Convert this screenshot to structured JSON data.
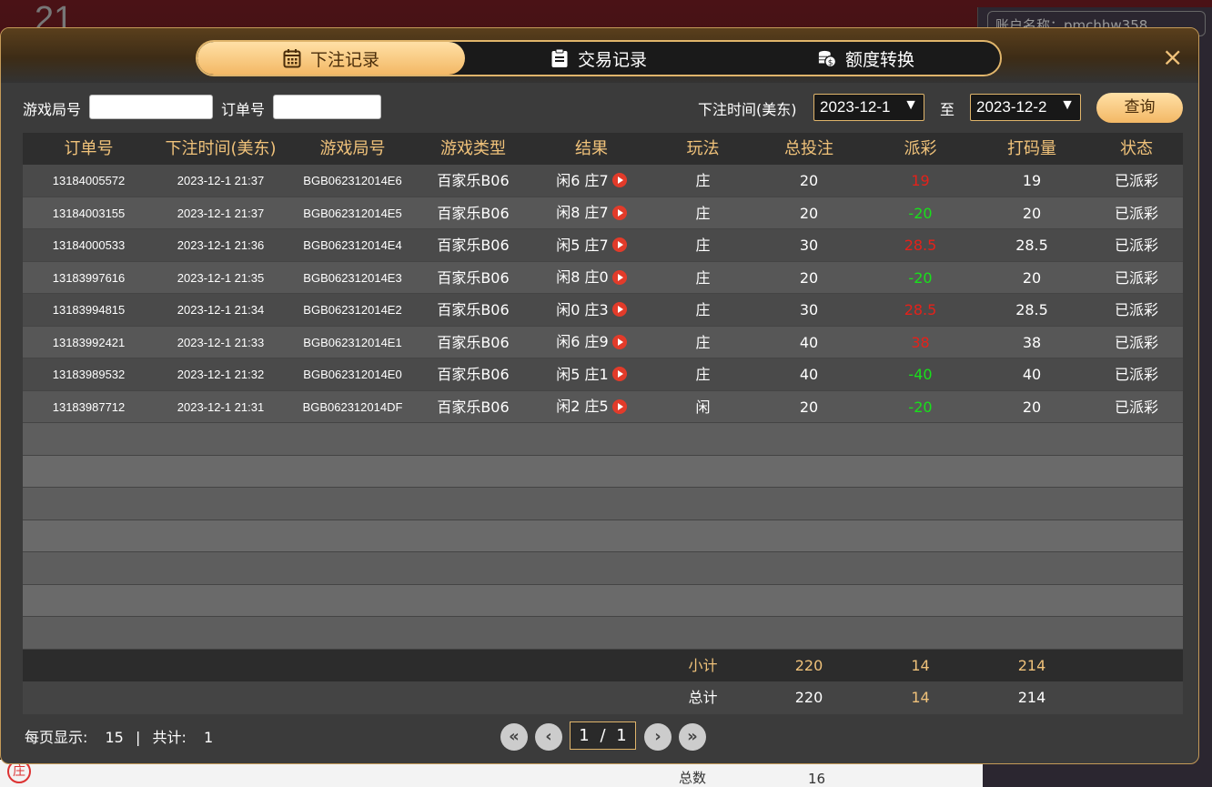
{
  "background": {
    "round_number": "21",
    "account_label": "账户名称：pmchhw358",
    "bottom_left_badge": "庄",
    "bottom_stat_label": "总数",
    "bottom_stat_value": "16"
  },
  "tabs": [
    {
      "label": "下注记录",
      "icon": "calendar-icon",
      "active": true
    },
    {
      "label": "交易记录",
      "icon": "clipboard-icon",
      "active": false
    },
    {
      "label": "额度转换",
      "icon": "coins-icon",
      "active": false
    }
  ],
  "close_label": "×",
  "filters": {
    "round_label": "游戏局号",
    "round_value": "",
    "order_label": "订单号",
    "order_value": "",
    "time_label": "下注时间(美东)",
    "date_from": "2023-12-1",
    "to_label": "至",
    "date_to": "2023-12-2",
    "query_label": "查询"
  },
  "table": {
    "headers": [
      "订单号",
      "下注时间(美东)",
      "游戏局号",
      "游戏类型",
      "结果",
      "玩法",
      "总投注",
      "派彩",
      "打码量",
      "状态"
    ],
    "rows": [
      {
        "order": "13184005572",
        "time": "2023-12-1 21:37",
        "round": "BGB062312014E6",
        "game": "百家乐B06",
        "result": "闲6 庄7",
        "play": "庄",
        "bet": "20",
        "payout": "19",
        "payout_sign": "pos",
        "turnover": "19",
        "status": "已派彩"
      },
      {
        "order": "13184003155",
        "time": "2023-12-1 21:37",
        "round": "BGB062312014E5",
        "game": "百家乐B06",
        "result": "闲8 庄7",
        "play": "庄",
        "bet": "20",
        "payout": "-20",
        "payout_sign": "neg",
        "turnover": "20",
        "status": "已派彩"
      },
      {
        "order": "13184000533",
        "time": "2023-12-1 21:36",
        "round": "BGB062312014E4",
        "game": "百家乐B06",
        "result": "闲5 庄7",
        "play": "庄",
        "bet": "30",
        "payout": "28.5",
        "payout_sign": "pos",
        "turnover": "28.5",
        "status": "已派彩"
      },
      {
        "order": "13183997616",
        "time": "2023-12-1 21:35",
        "round": "BGB062312014E3",
        "game": "百家乐B06",
        "result": "闲8 庄0",
        "play": "庄",
        "bet": "20",
        "payout": "-20",
        "payout_sign": "neg",
        "turnover": "20",
        "status": "已派彩"
      },
      {
        "order": "13183994815",
        "time": "2023-12-1 21:34",
        "round": "BGB062312014E2",
        "game": "百家乐B06",
        "result": "闲0 庄3",
        "play": "庄",
        "bet": "30",
        "payout": "28.5",
        "payout_sign": "pos",
        "turnover": "28.5",
        "status": "已派彩"
      },
      {
        "order": "13183992421",
        "time": "2023-12-1 21:33",
        "round": "BGB062312014E1",
        "game": "百家乐B06",
        "result": "闲6 庄9",
        "play": "庄",
        "bet": "40",
        "payout": "38",
        "payout_sign": "pos",
        "turnover": "38",
        "status": "已派彩"
      },
      {
        "order": "13183989532",
        "time": "2023-12-1 21:32",
        "round": "BGB062312014E0",
        "game": "百家乐B06",
        "result": "闲5 庄1",
        "play": "庄",
        "bet": "40",
        "payout": "-40",
        "payout_sign": "neg",
        "turnover": "40",
        "status": "已派彩"
      },
      {
        "order": "13183987712",
        "time": "2023-12-1 21:31",
        "round": "BGB062312014DF",
        "game": "百家乐B06",
        "result": "闲2 庄5",
        "play": "闲",
        "bet": "20",
        "payout": "-20",
        "payout_sign": "neg",
        "turnover": "20",
        "status": "已派彩"
      }
    ],
    "empty_rows": 7,
    "subtotal": {
      "label": "小计",
      "bet": "220",
      "payout": "14",
      "turnover": "214"
    },
    "total": {
      "label": "总计",
      "bet": "220",
      "payout": "14",
      "turnover": "214"
    }
  },
  "pagination": {
    "per_page_label": "每页显示:",
    "per_page_value": "15",
    "separator": "|",
    "total_label": "共计:",
    "total_value": "1",
    "current_page": "1",
    "slash": "/",
    "total_pages": "1",
    "first_glyph": "«",
    "prev_glyph": "‹",
    "next_glyph": "›",
    "last_glyph": "»"
  },
  "colors": {
    "accent_gold": "#f0c27a",
    "positive_payout": "#e5211a",
    "negative_payout": "#19e01b"
  }
}
